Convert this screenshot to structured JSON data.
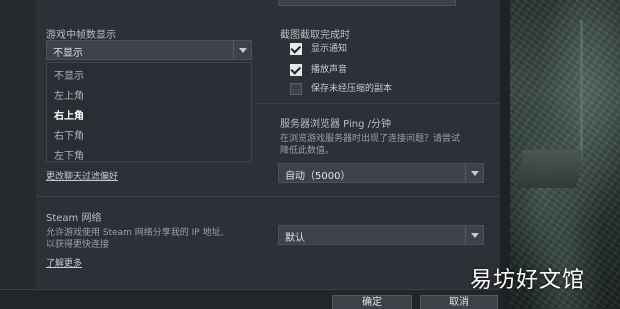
{
  "left_column": {
    "fps_label": "游戏中帧数显示",
    "fps_select_value": "不显示",
    "fps_options": [
      "不显示",
      "左上角",
      "右上角",
      "右下角",
      "左下角"
    ],
    "fps_active_index": 2,
    "chat_filter_link": "更改聊天过滤偏好",
    "steam_network_title": "Steam 网络",
    "steam_network_desc_1": "允许游戏使用 Steam 网络分享我的 IP 地址,",
    "steam_network_desc_2": "以获得更快连接",
    "learn_more_link": "了解更多"
  },
  "right_column": {
    "screenshot_done_title": "截图截取完成时",
    "options": [
      {
        "label": "显示通知",
        "checked": true
      },
      {
        "label": "播放声音",
        "checked": true
      },
      {
        "label": "保存未经压缩的副本",
        "checked": false
      }
    ],
    "ping_title": "服务器浏览器 Ping /分钟",
    "ping_desc_1": "在浏览游戏服务器时出现了连接问题？请尝试",
    "ping_desc_2": "降低此数值。",
    "ping_select_value": "自动（5000）",
    "network_select_value": "默认"
  },
  "footer": {
    "ok_label": "确定",
    "cancel_label": "取消"
  },
  "watermark": "易坊好文馆"
}
